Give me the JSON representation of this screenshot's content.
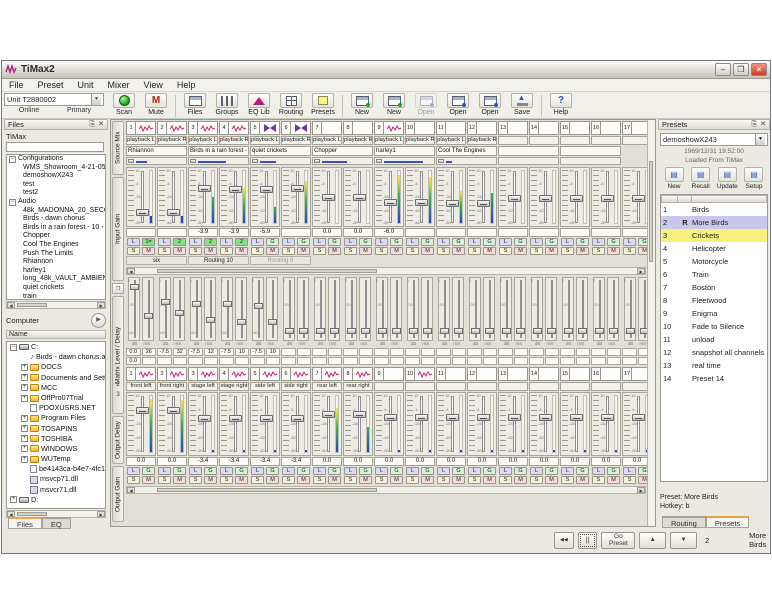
{
  "window": {
    "title": "TiMax2",
    "minimize": "–",
    "restore": "❐",
    "close": "×"
  },
  "menu": {
    "items": [
      "File",
      "Preset",
      "Unit",
      "Mixer",
      "View",
      "Help"
    ]
  },
  "toolbar": {
    "unit_combo": "Unit T2880002",
    "online_label": "Online",
    "primary_label": "Primary",
    "scan_label": "Scan",
    "mute_label": "Mute",
    "mute_letter": "M",
    "button_groups": [
      [
        {
          "label": "Files",
          "icon": "files-window-icon"
        },
        {
          "label": "Groups",
          "icon": "groups-bars-icon"
        },
        {
          "label": "EQ Lib",
          "icon": "eq-lib-triangle-icon"
        },
        {
          "label": "Routing",
          "icon": "routing-grid-icon"
        },
        {
          "label": "Presets",
          "icon": "presets-square-icon"
        }
      ],
      [
        {
          "label": "New",
          "icon": "new-window-icon"
        },
        {
          "label": "New",
          "icon": "new-window-icon"
        },
        {
          "label": "Open",
          "icon": "open-window-icon",
          "disabled": true
        },
        {
          "label": "Open",
          "icon": "open-window-icon"
        },
        {
          "label": "Open",
          "icon": "open-window-icon"
        },
        {
          "label": "Save",
          "icon": "save-arrow-icon"
        }
      ],
      [
        {
          "label": "Help",
          "icon": "help-icon"
        }
      ]
    ]
  },
  "files_panel": {
    "title": "Files",
    "subtitle": "TiMax",
    "filter_value": "",
    "tree": [
      {
        "label": "Configurations",
        "expanded": true,
        "children": [
          "WMS_Showroom_4-21-05",
          "demoshowX243",
          "test",
          "test2"
        ]
      },
      {
        "label": "Audio",
        "expanded": true,
        "children": [
          "48k_MADONNA_20_SECO",
          "Birds - dawn chorus",
          "Birds in a rain forest - 10 -",
          "Chopper",
          "Cool The Engines",
          "Push The Limits",
          "Rhiannon",
          "harley1",
          "long_48k_VAULT_AMBIEN",
          "quiet crickets",
          "train"
        ]
      }
    ],
    "computer_label": "Computer",
    "name_header": "Name",
    "computer_tree": [
      {
        "label": "C:",
        "type": "drive",
        "expander": "-",
        "children": [
          {
            "label": "Birds - dawn chorus.aif",
            "type": "audio"
          },
          {
            "label": "DOCS",
            "type": "folder",
            "expander": "+"
          },
          {
            "label": "Documents and Setting",
            "type": "folder",
            "expander": "+"
          },
          {
            "label": "MCC",
            "type": "folder",
            "expander": "+"
          },
          {
            "label": "OffPro07Trial",
            "type": "folder",
            "expander": "+"
          },
          {
            "label": "PDOXUSRS.NET",
            "type": "file"
          },
          {
            "label": "Program Files",
            "type": "folder",
            "expander": "+"
          },
          {
            "label": "TOSAPINS",
            "type": "folder",
            "expander": "+"
          },
          {
            "label": "TOSHIBA",
            "type": "folder",
            "expander": "+"
          },
          {
            "label": "WINDOWS",
            "type": "folder",
            "expander": "+"
          },
          {
            "label": "WUTemp",
            "type": "folder",
            "expander": "+"
          },
          {
            "label": "be4143ca-b4e7-4fc1-a",
            "type": "file"
          },
          {
            "label": "msvcp71.dll",
            "type": "dll"
          },
          {
            "label": "msvcr71.dll",
            "type": "dll"
          }
        ]
      },
      {
        "label": "D:",
        "type": "drive",
        "expander": "+",
        "children": []
      }
    ],
    "tabs": [
      {
        "label": "Files",
        "active": true
      },
      {
        "label": "EQ",
        "active": false
      }
    ]
  },
  "mixer": {
    "section_tabs": [
      "Source Mix",
      "Input Gain",
      "Matrix Level / Delay",
      "Output Delay",
      "Output Gain"
    ],
    "channels": [
      {
        "num": "1",
        "io": "playback L",
        "wave": "zigzag"
      },
      {
        "num": "2",
        "io": "playback R",
        "wave": "zigzag"
      },
      {
        "num": "3",
        "io": "playback L",
        "wave": "zigzag"
      },
      {
        "num": "4",
        "io": "playback R",
        "wave": "zigzag"
      },
      {
        "num": "5",
        "io": "playback L",
        "wave": "bowtie"
      },
      {
        "num": "6",
        "io": "playback R",
        "wave": "bowtie"
      },
      {
        "num": "7",
        "io": "playback L",
        "wave": ""
      },
      {
        "num": "8",
        "io": "playback R",
        "wave": ""
      },
      {
        "num": "9",
        "io": "playback L",
        "wave": "zigzag"
      },
      {
        "num": "10",
        "io": "playback R",
        "wave": ""
      },
      {
        "num": "11",
        "io": "playback L",
        "wave": ""
      },
      {
        "num": "12",
        "io": "playback R",
        "wave": ""
      },
      {
        "num": "13",
        "io": "",
        "wave": ""
      },
      {
        "num": "14",
        "io": "",
        "wave": ""
      },
      {
        "num": "15",
        "io": "",
        "wave": ""
      },
      {
        "num": "16",
        "io": "",
        "wave": ""
      },
      {
        "num": "17",
        "io": "",
        "wave": ""
      }
    ],
    "pairs": [
      {
        "name": "Rhiannon",
        "progress": 22
      },
      {
        "name": "Birds in a rain forest - 1",
        "progress": 55
      },
      {
        "name": "quiet crickets",
        "progress": 32
      },
      {
        "name": "Chopper",
        "progress": 50
      },
      {
        "name": "harley1",
        "progress": 78
      },
      {
        "name": "Cool The Engines",
        "progress": 12
      },
      {
        "name": "",
        "progress": null
      },
      {
        "name": "",
        "progress": null
      }
    ],
    "input_gain": {
      "scale": [
        "10",
        "5",
        "1",
        "-4",
        "-12",
        "-18",
        "-24",
        "-30",
        "-36",
        "-42",
        "-48",
        "-54",
        "-60"
      ],
      "values": [
        "",
        "",
        "-3.9",
        "-3.9",
        "-5.9",
        "",
        "0.0",
        "0.0",
        "-6.0",
        "",
        "",
        "",
        "",
        "",
        "",
        "",
        ""
      ],
      "link_label": "L",
      "solo_label": "S",
      "mute_label": "M",
      "group_labels": [
        "1=",
        "2",
        "2",
        "2",
        "G",
        "G",
        "G",
        "G",
        "G",
        "G",
        "G",
        "G",
        "G",
        "G",
        "G",
        "G",
        "G"
      ],
      "faders": [
        0.8,
        0.8,
        0.3,
        0.33,
        0.33,
        0.3,
        0.48,
        0.48,
        0.6,
        0.6,
        0.62,
        0.62,
        0.52,
        0.52,
        0.52,
        0.52,
        0.52
      ],
      "meters": [
        0.13,
        0.13,
        0.5,
        0.68,
        0.3,
        0.8,
        0,
        0,
        0.92,
        0.88,
        0.62,
        0.58,
        0,
        0,
        0,
        0,
        0
      ],
      "routing_groups": [
        "six",
        "Routing 10",
        "Routing 9",
        "",
        "",
        "",
        "",
        ""
      ],
      "routing_dim": [
        false,
        false,
        true,
        false,
        false,
        false,
        false,
        false
      ]
    },
    "matrix": {
      "scale": [
        "0",
        "-5",
        "-10",
        "-20",
        "-30",
        "-40",
        "-50",
        "-60"
      ],
      "unit_db": "dB",
      "unit_ms": "mS",
      "row_labels": [
        "2",
        "3"
      ],
      "row2": [
        [
          "0.0",
          "26"
        ],
        [
          "-7.5",
          "32"
        ],
        [
          "-7.5",
          "12"
        ],
        [
          "-7.5",
          "10"
        ],
        [
          "-7.5",
          "10"
        ],
        [
          "",
          ""
        ],
        [
          "",
          ""
        ],
        [
          "",
          ""
        ],
        [
          "",
          ""
        ],
        [
          "",
          ""
        ],
        [
          "",
          ""
        ],
        [
          "",
          ""
        ],
        [
          "",
          ""
        ],
        [
          "",
          ""
        ],
        [
          "",
          ""
        ],
        [
          "",
          ""
        ],
        [
          "",
          ""
        ]
      ],
      "row3": [
        [
          "0.0",
          ""
        ],
        [
          "",
          ""
        ],
        [
          "",
          ""
        ],
        [
          "",
          ""
        ],
        [
          "",
          ""
        ],
        [
          "",
          ""
        ],
        [
          "",
          ""
        ],
        [
          "",
          ""
        ],
        [
          "",
          ""
        ],
        [
          "",
          ""
        ],
        [
          "",
          ""
        ],
        [
          "",
          ""
        ],
        [
          "",
          ""
        ],
        [
          "",
          ""
        ],
        [
          "",
          ""
        ],
        [
          "",
          ""
        ],
        [
          "",
          ""
        ]
      ],
      "db_faders": [
        0.08,
        0.35,
        0.38,
        0.38,
        0.42,
        0.88,
        0.88,
        0.88,
        0.88,
        0.88,
        0.88,
        0.88,
        0.88,
        0.88,
        0.88,
        0.88,
        0.88
      ],
      "ms_faders": [
        0.62,
        0.55,
        0.68,
        0.72,
        0.72,
        0.88,
        0.88,
        0.88,
        0.88,
        0.88,
        0.88,
        0.88,
        0.88,
        0.88,
        0.88,
        0.88,
        0.88
      ]
    },
    "outputs": [
      {
        "num": "1",
        "name": "front left",
        "wave": "zigzag"
      },
      {
        "num": "2",
        "name": "front right",
        "wave": "zigzag"
      },
      {
        "num": "3",
        "name": "stage left",
        "wave": "zigzag"
      },
      {
        "num": "4",
        "name": "stage right",
        "wave": "zigzag"
      },
      {
        "num": "5",
        "name": "side left",
        "wave": "zigzag"
      },
      {
        "num": "6",
        "name": "side right",
        "wave": "zigzag"
      },
      {
        "num": "7",
        "name": "rear left",
        "wave": "zigzag"
      },
      {
        "num": "8",
        "name": "rear right",
        "wave": "zigzag"
      },
      {
        "num": "9",
        "name": "",
        "wave": ""
      },
      {
        "num": "10",
        "name": "",
        "wave": "zigzag"
      },
      {
        "num": "11",
        "name": "",
        "wave": ""
      },
      {
        "num": "12",
        "name": "",
        "wave": ""
      },
      {
        "num": "13",
        "name": "",
        "wave": ""
      },
      {
        "num": "14",
        "name": "",
        "wave": ""
      },
      {
        "num": "15",
        "name": "",
        "wave": ""
      },
      {
        "num": "16",
        "name": "",
        "wave": ""
      },
      {
        "num": "17",
        "name": "",
        "wave": ""
      }
    ],
    "output_gain": {
      "values": [
        "0.0",
        "0.0",
        "-3.4",
        "-3.4",
        "-3.4",
        "-3.4",
        "0.0",
        "0.0",
        "0.0",
        "0.0",
        "0.0",
        "0.0",
        "0.0",
        "0.0",
        "0.0",
        "0.0",
        "0.0"
      ],
      "link_label": "L",
      "group_label": "G",
      "solo_label": "S",
      "mute_label": "M",
      "faders": [
        0.22,
        0.22,
        0.38,
        0.38,
        0.38,
        0.38,
        0.3,
        0.3,
        0.35,
        0.35,
        0.35,
        0.35,
        0.35,
        0.35,
        0.35,
        0.35,
        0.35
      ],
      "meters": [
        0.95,
        0.93,
        0.04,
        0.04,
        0.04,
        0.04,
        0.78,
        0.45,
        0.04,
        0.04,
        0.04,
        0.04,
        0.04,
        0.04,
        0.04,
        0.04,
        0.04
      ]
    }
  },
  "presets_panel": {
    "title": "Presets",
    "show_combo": "demoshowX243",
    "timestamp": "1969/12/31 19:52:00",
    "loaded_from": "Loaded From TiMax",
    "buttons": [
      {
        "label": "New",
        "icon": "preset-new-icon"
      },
      {
        "label": "Recall",
        "icon": "preset-recall-icon"
      },
      {
        "label": "Update",
        "icon": "preset-update-icon"
      },
      {
        "label": "Setup",
        "icon": "preset-setup-icon"
      }
    ],
    "rows": [
      {
        "num": "1",
        "flag": "",
        "name": "Birds",
        "highlight": ""
      },
      {
        "num": "2",
        "flag": "R",
        "name": "More Birds",
        "highlight": "selected"
      },
      {
        "num": "3",
        "flag": "",
        "name": "Crickets",
        "highlight": "marked"
      },
      {
        "num": "4",
        "flag": "",
        "name": "Helicopter",
        "highlight": ""
      },
      {
        "num": "5",
        "flag": "",
        "name": "Motorcycle",
        "highlight": ""
      },
      {
        "num": "6",
        "flag": "",
        "name": "Train",
        "highlight": ""
      },
      {
        "num": "7",
        "flag": "",
        "name": "Boston",
        "highlight": ""
      },
      {
        "num": "8",
        "flag": "",
        "name": "Fleetwood",
        "highlight": ""
      },
      {
        "num": "9",
        "flag": "",
        "name": "Enigma",
        "highlight": ""
      },
      {
        "num": "10",
        "flag": "",
        "name": "Fade to Silence",
        "highlight": ""
      },
      {
        "num": "11",
        "flag": "",
        "name": "unload",
        "highlight": ""
      },
      {
        "num": "12",
        "flag": "",
        "name": "snapshot all channels",
        "highlight": ""
      },
      {
        "num": "13",
        "flag": "",
        "name": "real time",
        "highlight": ""
      },
      {
        "num": "14",
        "flag": "",
        "name": "Preset 14",
        "highlight": ""
      }
    ],
    "footer_preset": "Preset: More Birds",
    "footer_hotkey": "Hotkey: b",
    "tabs": [
      {
        "label": "Routing",
        "active": false
      },
      {
        "label": "Presets",
        "active": true
      }
    ]
  },
  "transport": {
    "rewind": "◀◀",
    "pause": "||",
    "go_label": "Go Preset",
    "up": "▲",
    "down": "▼",
    "current_num": "2",
    "current_name": "More Birds"
  },
  "colors": {
    "accent_orange": "#f0a14c",
    "selected_row": "#c9c8ec",
    "marked_row": "#f6f07c",
    "meter_low": "#2a3fd4",
    "meter_mid": "#35b44a",
    "meter_high": "#e8e23a",
    "wave_pink": "#cc2277",
    "wave_purple": "#7733aa",
    "progress_blue": "#3a4ed0",
    "link_btn": "#dcd9f2",
    "group_btn": "#d8f0d8",
    "group_btn_bright": "#86e086",
    "solo_btn": "#f4f1d6",
    "mute_btn": "#f6dada"
  }
}
